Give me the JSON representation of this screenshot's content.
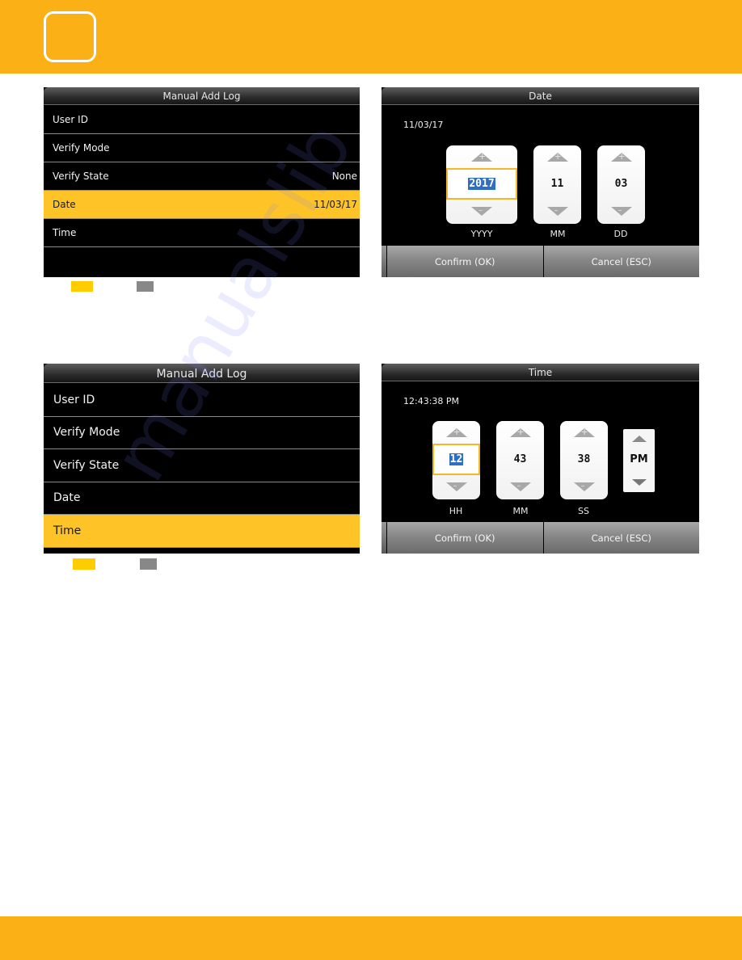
{
  "colors": {
    "band": "#fbb116",
    "selected_row": "#fec427",
    "focus_border": "#f4b72a",
    "selection_highlight": "#2f6ec0",
    "legend_yellow": "#ffcc00",
    "legend_gray": "#888888"
  },
  "screen_date_menu": {
    "title": "Manual Add Log",
    "items": [
      {
        "label": "User ID",
        "value": ""
      },
      {
        "label": "Verify Mode",
        "value": ""
      },
      {
        "label": "Verify State",
        "value": "None"
      },
      {
        "label": "Date",
        "value": "11/03/17",
        "selected": true
      },
      {
        "label": "Time",
        "value": ""
      }
    ]
  },
  "screen_date_picker": {
    "title": "Date",
    "current_value": "11/03/17",
    "spinners": [
      {
        "value": "2017",
        "label": "YYYY",
        "focused": true
      },
      {
        "value": "11",
        "label": "MM"
      },
      {
        "value": "03",
        "label": "DD"
      }
    ],
    "confirm_label": "Confirm (OK)",
    "cancel_label": "Cancel (ESC)"
  },
  "screen_time_menu": {
    "title": "Manual Add Log",
    "items": [
      {
        "label": "User ID"
      },
      {
        "label": "Verify Mode"
      },
      {
        "label": "Verify State"
      },
      {
        "label": "Date"
      },
      {
        "label": "Time",
        "selected": true
      }
    ]
  },
  "screen_time_picker": {
    "title": "Time",
    "current_value": "12:43:38 PM",
    "spinners": [
      {
        "value": "12",
        "label": "HH",
        "focused": true
      },
      {
        "value": "43",
        "label": "MM"
      },
      {
        "value": "38",
        "label": "SS"
      }
    ],
    "ampm": "PM",
    "confirm_label": "Confirm (OK)",
    "cancel_label": "Cancel (ESC)"
  },
  "watermark": "manualslib"
}
